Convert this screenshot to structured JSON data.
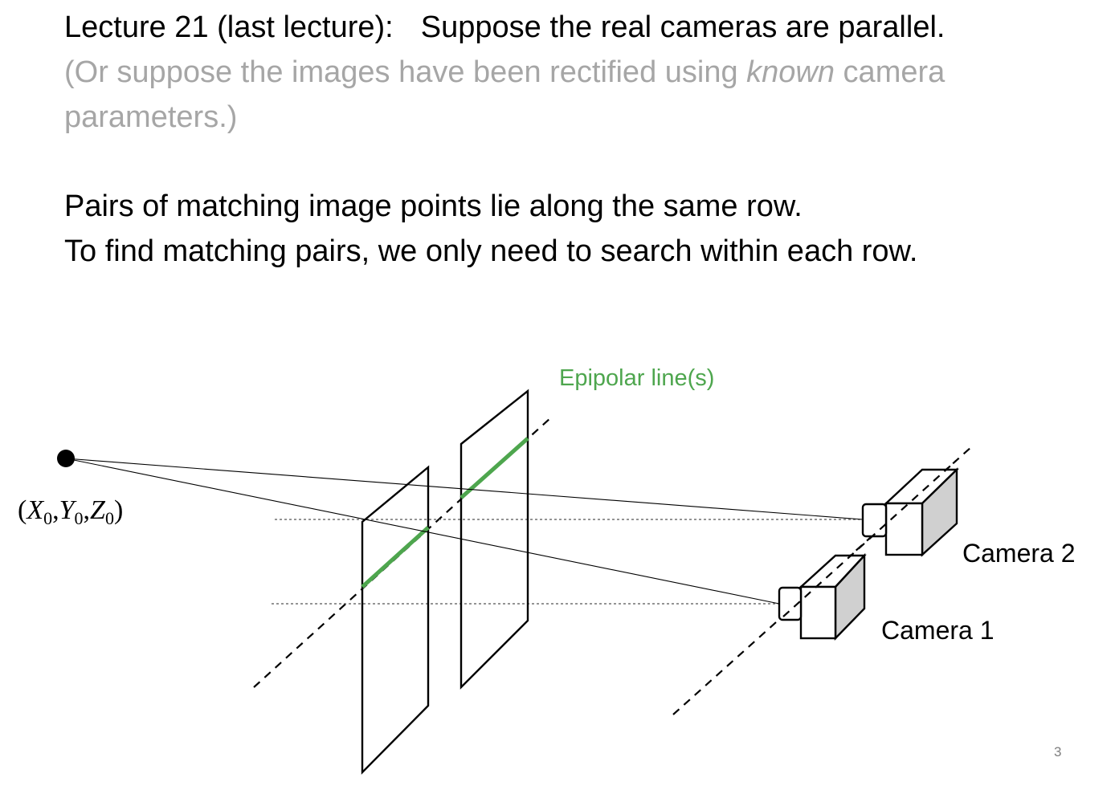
{
  "slide": {
    "line1_part1": "Lecture 21 (last lecture):",
    "line1_part2": "Suppose the real cameras are parallel.",
    "line2_part1": "(Or suppose the images have been rectified using ",
    "line2_emph": "known",
    "line2_part2": " camera",
    "line3": "parameters.)",
    "line4": "Pairs of matching image points lie along the same row.",
    "line5": "To find matching pairs,  we only need to search within each row.",
    "page_number": "3"
  },
  "diagram": {
    "epipolar_label": "Epipolar line(s)",
    "point_label": {
      "open": "(",
      "x": "X",
      "x_sub": "0",
      "comma1": ",",
      "y": "Y",
      "y_sub": "0",
      "comma2": ",",
      "z": "Z",
      "z_sub": "0",
      "close": ")"
    },
    "camera1_label": "Camera 1",
    "camera2_label": "Camera 2",
    "colors": {
      "epipolar": "#4ea64e",
      "line": "#000000",
      "camera_side": "#d0d0d0"
    }
  }
}
